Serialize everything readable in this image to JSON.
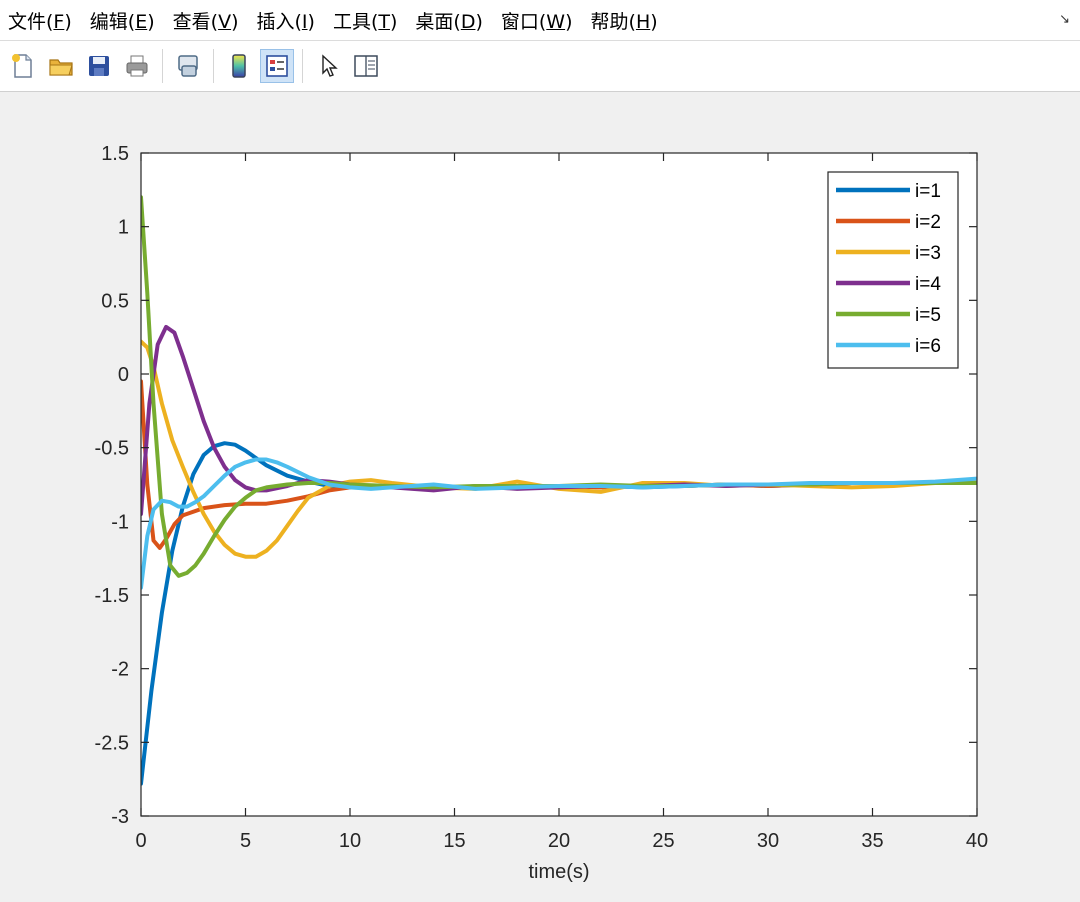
{
  "menu": {
    "items": [
      {
        "label_pre": "文件(",
        "key": "F",
        "label_post": ")"
      },
      {
        "label_pre": "编辑(",
        "key": "E",
        "label_post": ")"
      },
      {
        "label_pre": "查看(",
        "key": "V",
        "label_post": ")"
      },
      {
        "label_pre": "插入(",
        "key": "I",
        "label_post": ")"
      },
      {
        "label_pre": "工具(",
        "key": "T",
        "label_post": ")"
      },
      {
        "label_pre": "桌面(",
        "key": "D",
        "label_post": ")"
      },
      {
        "label_pre": "窗口(",
        "key": "W",
        "label_post": ")"
      },
      {
        "label_pre": "帮助(",
        "key": "H",
        "label_post": ")"
      }
    ],
    "corner_glyph": "↘"
  },
  "toolbar": {
    "buttons": [
      "new-file-icon",
      "open-folder-icon",
      "save-icon",
      "print-icon",
      "link-icon",
      "colorbar-icon",
      "legend-icon",
      "pointer-icon",
      "property-editor-icon"
    ],
    "active": "legend-icon"
  },
  "chart_data": {
    "type": "line",
    "xlabel": "time(s)",
    "ylabel": "",
    "xlim": [
      0,
      40
    ],
    "ylim": [
      -3,
      1.5
    ],
    "xticks": [
      0,
      5,
      10,
      15,
      20,
      25,
      30,
      35,
      40
    ],
    "yticks": [
      -3,
      -2.5,
      -2,
      -1.5,
      -1,
      -0.5,
      0,
      0.5,
      1,
      1.5
    ],
    "grid": false,
    "legend_position": "top-right",
    "series": [
      {
        "name": "i=1",
        "color": "#0072bd",
        "x": [
          0,
          0.5,
          1,
          1.5,
          2,
          2.5,
          3,
          3.5,
          4,
          4.5,
          5,
          5.5,
          6,
          7,
          8,
          9,
          10,
          12,
          14,
          16,
          18,
          20,
          22,
          24,
          26,
          28,
          30,
          32,
          34,
          36,
          38,
          40
        ],
        "y": [
          -2.78,
          -2.15,
          -1.62,
          -1.2,
          -0.9,
          -0.68,
          -0.55,
          -0.49,
          -0.47,
          -0.48,
          -0.52,
          -0.57,
          -0.62,
          -0.69,
          -0.73,
          -0.76,
          -0.77,
          -0.76,
          -0.77,
          -0.77,
          -0.76,
          -0.77,
          -0.76,
          -0.77,
          -0.76,
          -0.75,
          -0.76,
          -0.75,
          -0.74,
          -0.74,
          -0.74,
          -0.73
        ]
      },
      {
        "name": "i=2",
        "color": "#d95319",
        "x": [
          0,
          0.3,
          0.6,
          0.9,
          1.2,
          1.6,
          2,
          3,
          4,
          5,
          6,
          7,
          8,
          9,
          10,
          11,
          12,
          14,
          16,
          18,
          20,
          22,
          24,
          26,
          28,
          30,
          32,
          34,
          36,
          38,
          40
        ],
        "y": [
          -0.05,
          -0.75,
          -1.13,
          -1.18,
          -1.12,
          -1.02,
          -0.96,
          -0.91,
          -0.89,
          -0.88,
          -0.88,
          -0.86,
          -0.83,
          -0.79,
          -0.77,
          -0.76,
          -0.76,
          -0.77,
          -0.77,
          -0.76,
          -0.76,
          -0.77,
          -0.76,
          -0.76,
          -0.75,
          -0.76,
          -0.75,
          -0.74,
          -0.74,
          -0.74,
          -0.74
        ]
      },
      {
        "name": "i=3",
        "color": "#edb120",
        "x": [
          0,
          0.3,
          0.6,
          1,
          1.5,
          2,
          2.5,
          3,
          3.5,
          4,
          4.5,
          5,
          5.5,
          6,
          6.5,
          7,
          7.5,
          8,
          9,
          10,
          11,
          12,
          14,
          16,
          18,
          20,
          22,
          24,
          26,
          28,
          30,
          32,
          34,
          36,
          38,
          40
        ],
        "y": [
          0.22,
          0.18,
          0.05,
          -0.2,
          -0.45,
          -0.63,
          -0.8,
          -0.95,
          -1.07,
          -1.16,
          -1.22,
          -1.24,
          -1.24,
          -1.2,
          -1.13,
          -1.03,
          -0.93,
          -0.84,
          -0.76,
          -0.73,
          -0.72,
          -0.74,
          -0.77,
          -0.78,
          -0.73,
          -0.78,
          -0.8,
          -0.74,
          -0.74,
          -0.76,
          -0.75,
          -0.76,
          -0.77,
          -0.76,
          -0.74,
          -0.73
        ]
      },
      {
        "name": "i=4",
        "color": "#7e2f8e",
        "x": [
          0,
          0.4,
          0.8,
          1.2,
          1.6,
          2,
          2.5,
          3,
          3.5,
          4,
          4.5,
          5,
          5.5,
          6,
          7,
          8,
          9,
          10,
          12,
          14,
          16,
          18,
          20,
          22,
          24,
          26,
          28,
          30,
          32,
          34,
          36,
          38,
          40
        ],
        "y": [
          -0.95,
          -0.2,
          0.2,
          0.32,
          0.28,
          0.12,
          -0.1,
          -0.32,
          -0.5,
          -0.63,
          -0.72,
          -0.77,
          -0.79,
          -0.79,
          -0.76,
          -0.72,
          -0.73,
          -0.75,
          -0.77,
          -0.79,
          -0.76,
          -0.78,
          -0.77,
          -0.76,
          -0.76,
          -0.75,
          -0.76,
          -0.75,
          -0.75,
          -0.74,
          -0.74,
          -0.74,
          -0.74
        ]
      },
      {
        "name": "i=5",
        "color": "#77ac30",
        "x": [
          0,
          0.3,
          0.6,
          1,
          1.4,
          1.8,
          2.2,
          2.6,
          3,
          3.5,
          4,
          4.5,
          5,
          5.5,
          6,
          7,
          8,
          9,
          10,
          12,
          14,
          16,
          18,
          20,
          22,
          24,
          26,
          28,
          30,
          32,
          34,
          36,
          38,
          40
        ],
        "y": [
          1.2,
          0.55,
          -0.2,
          -0.95,
          -1.3,
          -1.37,
          -1.35,
          -1.3,
          -1.22,
          -1.1,
          -0.99,
          -0.9,
          -0.84,
          -0.79,
          -0.77,
          -0.75,
          -0.74,
          -0.74,
          -0.75,
          -0.76,
          -0.77,
          -0.76,
          -0.76,
          -0.76,
          -0.75,
          -0.76,
          -0.76,
          -0.75,
          -0.75,
          -0.75,
          -0.74,
          -0.74,
          -0.74,
          -0.74
        ]
      },
      {
        "name": "i=6",
        "color": "#4dbeee",
        "x": [
          0,
          0.3,
          0.6,
          1,
          1.4,
          1.8,
          2.2,
          2.6,
          3,
          3.5,
          4,
          4.5,
          5,
          5.5,
          6,
          6.5,
          7,
          8,
          9,
          10,
          11,
          12,
          14,
          16,
          18,
          20,
          22,
          24,
          26,
          28,
          30,
          32,
          34,
          36,
          38,
          40
        ],
        "y": [
          -1.45,
          -1.1,
          -0.92,
          -0.86,
          -0.87,
          -0.9,
          -0.9,
          -0.87,
          -0.83,
          -0.76,
          -0.69,
          -0.63,
          -0.6,
          -0.58,
          -0.58,
          -0.6,
          -0.63,
          -0.7,
          -0.75,
          -0.77,
          -0.78,
          -0.77,
          -0.75,
          -0.78,
          -0.77,
          -0.76,
          -0.76,
          -0.77,
          -0.76,
          -0.75,
          -0.75,
          -0.74,
          -0.74,
          -0.74,
          -0.73,
          -0.71
        ]
      }
    ]
  }
}
